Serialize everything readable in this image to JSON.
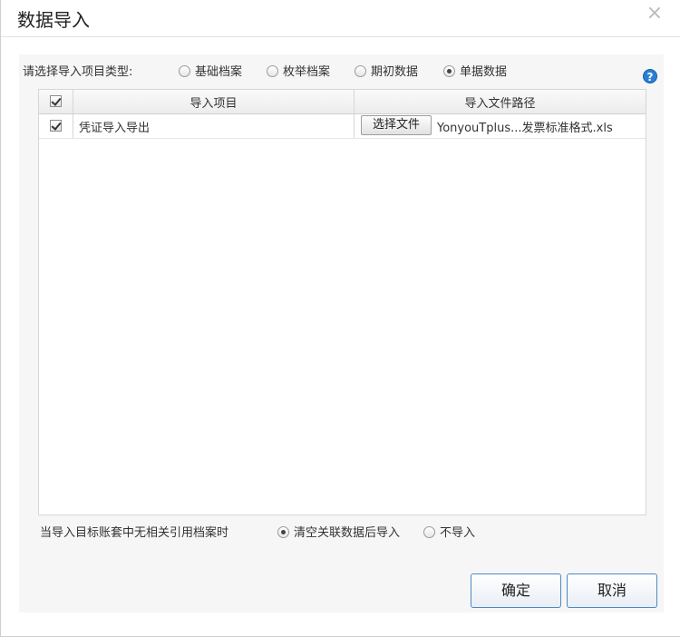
{
  "dialog": {
    "title": "数据导入",
    "close_glyph": "×"
  },
  "import_type": {
    "label": "请选择导入项目类型:",
    "options": [
      {
        "label": "基础档案",
        "checked": false
      },
      {
        "label": "枚举档案",
        "checked": false
      },
      {
        "label": "期初数据",
        "checked": false
      },
      {
        "label": "单据数据",
        "checked": true
      }
    ]
  },
  "help": {
    "glyph": "?"
  },
  "grid": {
    "columns": [
      "导入项目",
      "导入文件路径"
    ],
    "header_checked": true,
    "rows": [
      {
        "checked": true,
        "item": "凭证导入导出",
        "button_label": "选择文件",
        "path": "YonyouTplus...发票标准格式.xls"
      }
    ]
  },
  "missing_archive": {
    "label": "当导入目标账套中无相关引用档案时",
    "options": [
      {
        "label": "清空关联数据后导入",
        "checked": true
      },
      {
        "label": "不导入",
        "checked": false
      }
    ]
  },
  "footer": {
    "ok_label": "确定",
    "cancel_label": "取消"
  },
  "colors": {
    "accent_border": "#4d88c4",
    "help_icon": "#2a7fd4",
    "panel_bg": "#f6f6f6"
  },
  "icons": {
    "close": "close-icon",
    "help": "help-icon"
  }
}
